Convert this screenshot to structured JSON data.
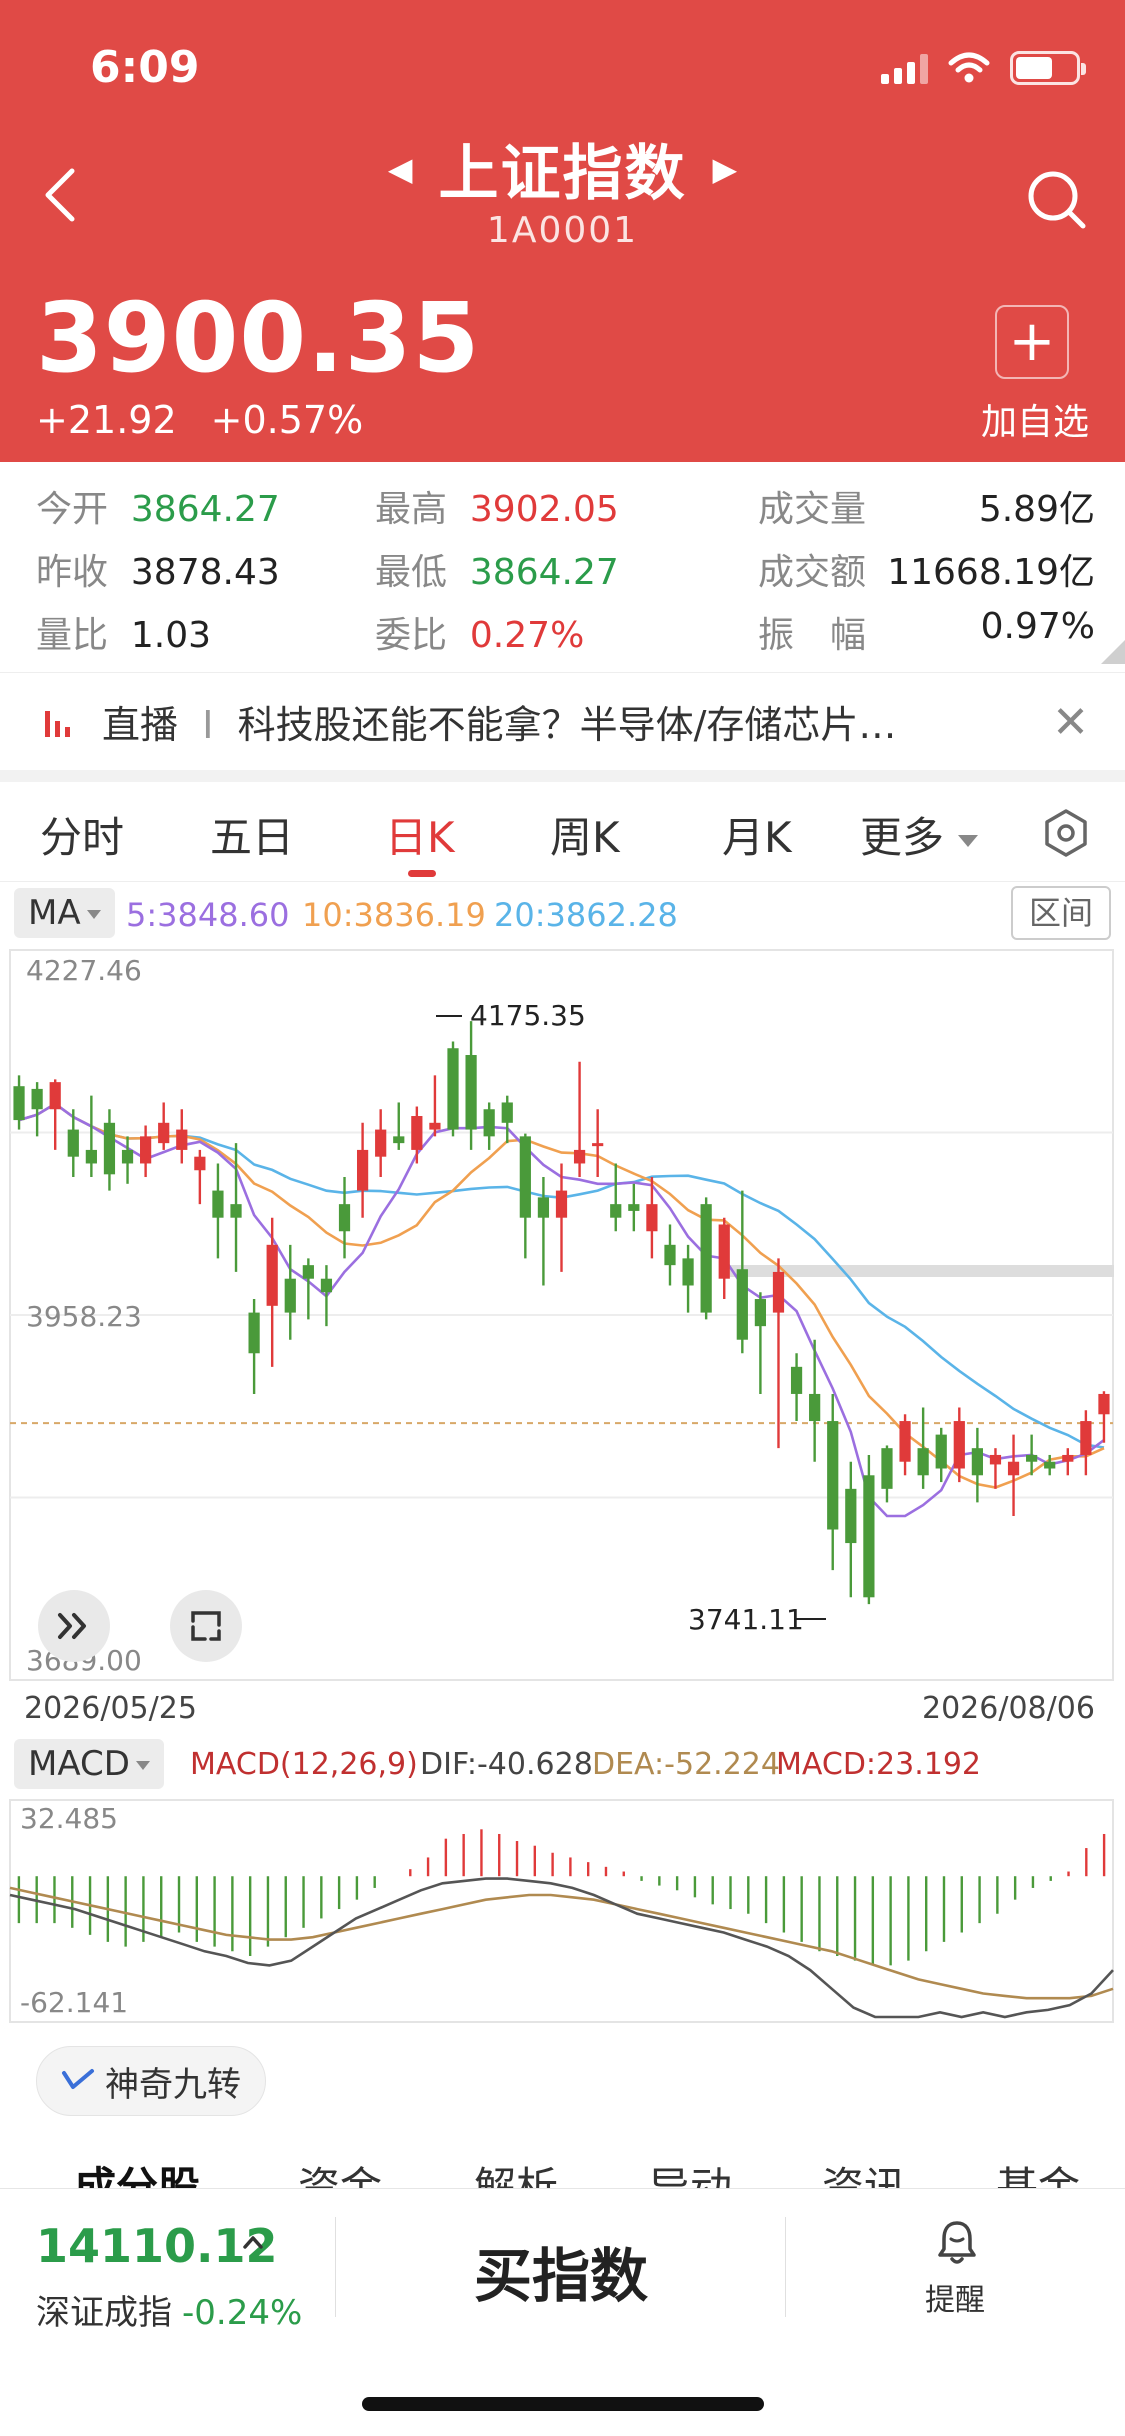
{
  "status": {
    "time": "6:09"
  },
  "header": {
    "title": "上证指数",
    "code": "1A0001",
    "price": "3900.35",
    "change": "+21.92",
    "change_pct": "+0.57%",
    "add_label": "加自选",
    "color": "#e04a46"
  },
  "stats": {
    "open_label": "今开",
    "open": "3864.27",
    "high_label": "最高",
    "high": "3902.05",
    "volume_label": "成交量",
    "volume": "5.89亿",
    "prev_label": "昨收",
    "prev": "3878.43",
    "low_label": "最低",
    "low": "3864.27",
    "amount_label": "成交额",
    "amount": "11668.19亿",
    "vr_label": "量比",
    "vr": "1.03",
    "wb_label": "委比",
    "wb": "0.27%",
    "amp_label": "振　幅",
    "amp": "0.97%"
  },
  "live": {
    "label": "直播",
    "sep": "I",
    "text": "科技股还能不能拿？半导体/存储芯片…"
  },
  "tabs": [
    "分时",
    "五日",
    "日K",
    "周K",
    "月K",
    "更多"
  ],
  "active_tab": "日K",
  "ma": {
    "selector": "MA",
    "ma5": "5:3848.60",
    "ma10": "10:3836.19",
    "ma20": "20:3862.28",
    "range_btn": "区间",
    "colors": {
      "ma5": "#9b6fe0",
      "ma10": "#f0a050",
      "ma20": "#5ab4e8"
    }
  },
  "kline": {
    "y_top": "4227.46",
    "y_mid": "3958.23",
    "y_bot": "3689.00",
    "high_annot": "4175.35",
    "low_annot": "3741.11",
    "date_start": "2026/05/25",
    "date_end": "2026/08/06"
  },
  "macd": {
    "selector": "MACD",
    "params": "MACD(12,26,9)",
    "dif": "DIF:-40.628",
    "dea": "DEA:-52.224",
    "macd": "MACD:23.192",
    "y_top": "32.485",
    "y_bot": "-62.141"
  },
  "magic": {
    "label": "神奇九转"
  },
  "subtabs": [
    "成分股",
    "资金",
    "解析",
    "异动",
    "资讯",
    "基金"
  ],
  "bottom": {
    "price": "14110.12",
    "name": "深证成指",
    "pct": "-0.24%",
    "buy": "买指数",
    "remind": "提醒"
  },
  "chart_data": {
    "type": "candlestick",
    "x_start": "2026/05/25",
    "x_end": "2026/08/06",
    "ylim": [
      3689.0,
      4227.46
    ],
    "candles": [
      [
        4127,
        4102,
        4135,
        4095
      ],
      [
        4125,
        4110,
        4130,
        4090
      ],
      [
        4110,
        4130,
        4132,
        4080
      ],
      [
        4095,
        4075,
        4110,
        4060
      ],
      [
        4080,
        4070,
        4120,
        4060
      ],
      [
        4100,
        4062,
        4110,
        4050
      ],
      [
        4080,
        4070,
        4090,
        4055
      ],
      [
        4070,
        4090,
        4098,
        4060
      ],
      [
        4085,
        4100,
        4115,
        4080
      ],
      [
        4080,
        4095,
        4110,
        4070
      ],
      [
        4065,
        4075,
        4080,
        4040
      ],
      [
        4050,
        4030,
        4070,
        4000
      ],
      [
        4040,
        4030,
        4085,
        3990
      ],
      [
        3960,
        3930,
        3970,
        3900
      ],
      [
        3965,
        4010,
        4030,
        3920
      ],
      [
        3985,
        3960,
        4010,
        3940
      ],
      [
        3995,
        3985,
        4000,
        3955
      ],
      [
        3985,
        3975,
        3995,
        3950
      ],
      [
        4040,
        4020,
        4060,
        4000
      ],
      [
        4050,
        4080,
        4100,
        4030
      ],
      [
        4075,
        4095,
        4110,
        4060
      ],
      [
        4090,
        4085,
        4115,
        4080
      ],
      [
        4080,
        4105,
        4112,
        4070
      ],
      [
        4095,
        4100,
        4135,
        4090
      ],
      [
        4155,
        4095,
        4160,
        4090
      ],
      [
        4150,
        4095,
        4175,
        4080
      ],
      [
        4110,
        4090,
        4115,
        4080
      ],
      [
        4115,
        4100,
        4120,
        4085
      ],
      [
        4090,
        4030,
        4092,
        4000
      ],
      [
        4045,
        4030,
        4060,
        3980
      ],
      [
        4030,
        4050,
        4070,
        3990
      ],
      [
        4070,
        4080,
        4145,
        4060
      ],
      [
        4085,
        4085,
        4110,
        4060
      ],
      [
        4040,
        4030,
        4070,
        4020
      ],
      [
        4040,
        4035,
        4055,
        4020
      ],
      [
        4020,
        4040,
        4060,
        4000
      ],
      [
        4010,
        3995,
        4025,
        3980
      ],
      [
        4000,
        3980,
        4010,
        3960
      ],
      [
        4040,
        3960,
        4045,
        3955
      ],
      [
        3985,
        4025,
        4030,
        3970
      ],
      [
        3992,
        3940,
        4050,
        3930
      ],
      [
        3970,
        3950,
        3975,
        3900
      ],
      [
        3960,
        3990,
        4000,
        3860
      ],
      [
        3920,
        3900,
        3930,
        3880
      ],
      [
        3900,
        3880,
        3940,
        3850
      ],
      [
        3880,
        3800,
        3900,
        3770
      ],
      [
        3830,
        3790,
        3850,
        3750
      ],
      [
        3840,
        3750,
        3855,
        3745
      ],
      [
        3860,
        3830,
        3862,
        3820
      ],
      [
        3850,
        3880,
        3885,
        3840
      ],
      [
        3860,
        3840,
        3890,
        3830
      ],
      [
        3870,
        3845,
        3875,
        3835
      ],
      [
        3845,
        3880,
        3890,
        3835
      ],
      [
        3860,
        3840,
        3875,
        3820
      ],
      [
        3848,
        3855,
        3860,
        3830
      ],
      [
        3840,
        3850,
        3870,
        3810
      ],
      [
        3855,
        3850,
        3870,
        3840
      ],
      [
        3850,
        3845,
        3855,
        3840
      ],
      [
        3850,
        3855,
        3860,
        3840
      ],
      [
        3855,
        3880,
        3888,
        3840
      ],
      [
        3885,
        3900,
        3902,
        3864
      ]
    ],
    "ma5": "5:3848.60",
    "ma10": "10:3836.19",
    "ma20": "20:3862.28",
    "macd_ylim": [
      -62.141,
      32.485
    ],
    "macd_hist": [
      -20,
      -20,
      -20,
      -22,
      -25,
      -28,
      -30,
      -28,
      -26,
      -24,
      -28,
      -30,
      -32,
      -34,
      -30,
      -26,
      -22,
      -18,
      -14,
      -10,
      -5,
      0,
      3,
      8,
      16,
      18,
      20,
      18,
      15,
      13,
      10,
      8,
      6,
      4,
      2,
      -2,
      -4,
      -6,
      -9,
      -12,
      -14,
      -16,
      -20,
      -24,
      -28,
      -32,
      -34,
      -36,
      -38,
      -38,
      -36,
      -32,
      -28,
      -24,
      -20,
      -16,
      -10,
      -5,
      -2,
      2,
      12,
      18
    ],
    "macd_dif": [
      -8,
      -10,
      -12,
      -14,
      -17,
      -20,
      -23,
      -26,
      -29,
      -32,
      -34,
      -37,
      -38,
      -36,
      -30,
      -24,
      -18,
      -14,
      -10,
      -6,
      -3,
      -2,
      -1,
      -1,
      -2,
      -3,
      -5,
      -8,
      -12,
      -16,
      -18,
      -20,
      -22,
      -24,
      -27,
      -30,
      -34,
      -40,
      -48,
      -56,
      -60,
      -60,
      -60,
      -58,
      -60,
      -58,
      -60,
      -58,
      -57,
      -55,
      -50,
      -40
    ],
    "macd_dea": [
      -5,
      -7,
      -9,
      -11,
      -13,
      -15,
      -17,
      -19,
      -21,
      -23,
      -25,
      -26,
      -27,
      -27,
      -26,
      -24,
      -22,
      -20,
      -18,
      -16,
      -14,
      -12,
      -10,
      -9,
      -8,
      -8,
      -9,
      -10,
      -12,
      -14,
      -16,
      -18,
      -20,
      -22,
      -24,
      -26,
      -28,
      -30,
      -32,
      -35,
      -38,
      -41,
      -44,
      -46,
      -48,
      -50,
      -51,
      -52,
      -52,
      -52,
      -51,
      -48
    ]
  }
}
